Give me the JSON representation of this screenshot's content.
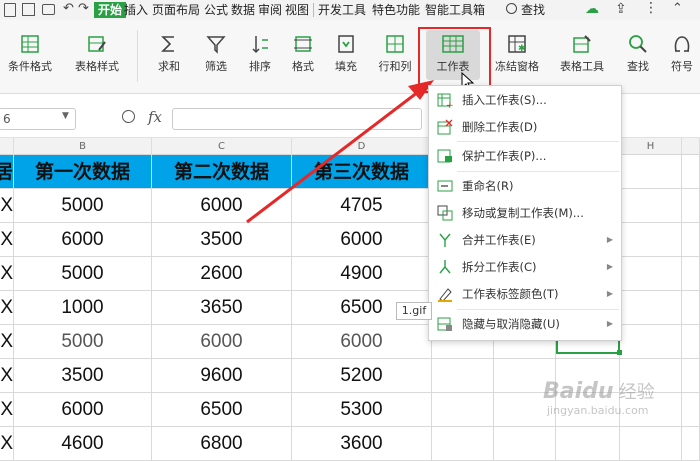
{
  "menubar": {
    "tabs": [
      "开始",
      "插入",
      "页面布局",
      "公式",
      "数据",
      "审阅",
      "视图",
      "开发工具",
      "特色功能",
      "智能工具箱"
    ],
    "search_label": "查找"
  },
  "ribbon": {
    "items": [
      {
        "label": "条件格式",
        "icon": "conditional-format-icon",
        "dropdown": true
      },
      {
        "label": "表格样式",
        "icon": "table-style-icon",
        "dropdown": true
      },
      {
        "label": "求和",
        "icon": "sum-icon",
        "dropdown": true
      },
      {
        "label": "筛选",
        "icon": "filter-icon",
        "dropdown": true
      },
      {
        "label": "排序",
        "icon": "sort-icon",
        "dropdown": true
      },
      {
        "label": "格式",
        "icon": "format-icon",
        "dropdown": true
      },
      {
        "label": "填充",
        "icon": "fill-icon",
        "dropdown": true
      },
      {
        "label": "行和列",
        "icon": "row-column-icon",
        "dropdown": true
      },
      {
        "label": "工作表",
        "icon": "worksheet-icon",
        "dropdown": true
      },
      {
        "label": "冻结窗格",
        "icon": "freeze-panes-icon",
        "dropdown": true
      },
      {
        "label": "表格工具",
        "icon": "table-tools-icon",
        "dropdown": true
      },
      {
        "label": "查找",
        "icon": "find-icon",
        "dropdown": true
      },
      {
        "label": "符号",
        "icon": "symbol-icon",
        "dropdown": true
      }
    ]
  },
  "formula_bar": {
    "namebox_value": "6",
    "fx_label": "fx"
  },
  "columns": [
    "B",
    "C",
    "D",
    "H"
  ],
  "table": {
    "headers": [
      "第一次数据",
      "第二次数据",
      "第三次数据"
    ],
    "rows": [
      [
        "5000",
        "6000",
        "4705"
      ],
      [
        "6000",
        "3500",
        "6000"
      ],
      [
        "5000",
        "2600",
        "4900"
      ],
      [
        "1000",
        "3650",
        "6500"
      ],
      [
        "5000",
        "6000",
        "6000"
      ],
      [
        "3500",
        "9600",
        "5200"
      ],
      [
        "6000",
        "6500",
        "5300"
      ],
      [
        "4600",
        "6800",
        "3600"
      ]
    ],
    "left_edge_header": "居",
    "left_edge_value": "X"
  },
  "context_menu": {
    "items": [
      {
        "label": "插入工作表(S)...",
        "icon": "insert-sheet-icon",
        "submenu": false
      },
      {
        "label": "删除工作表(D)",
        "icon": "delete-sheet-icon",
        "submenu": false
      },
      {
        "label": "保护工作表(P)...",
        "icon": "protect-sheet-icon",
        "submenu": false
      },
      {
        "label": "重命名(R)",
        "icon": "rename-icon",
        "submenu": false
      },
      {
        "label": "移动或复制工作表(M)...",
        "icon": "move-copy-icon",
        "submenu": false
      },
      {
        "label": "合并工作表(E)",
        "icon": "merge-sheet-icon",
        "submenu": true
      },
      {
        "label": "拆分工作表(C)",
        "icon": "split-sheet-icon",
        "submenu": true
      },
      {
        "label": "工作表标签颜色(T)",
        "icon": "tab-color-icon",
        "submenu": true
      },
      {
        "label": "隐藏与取消隐藏(U)",
        "icon": "hide-unhide-icon",
        "submenu": true
      }
    ]
  },
  "tooltip": "1.gif",
  "watermark": {
    "brand": "Baidu",
    "sub": "经验",
    "url": "jingyan.baidu.com"
  },
  "colors": {
    "accent_green": "#2aa045",
    "header_blue": "#00a2e8",
    "annotation_red": "#e62828"
  }
}
